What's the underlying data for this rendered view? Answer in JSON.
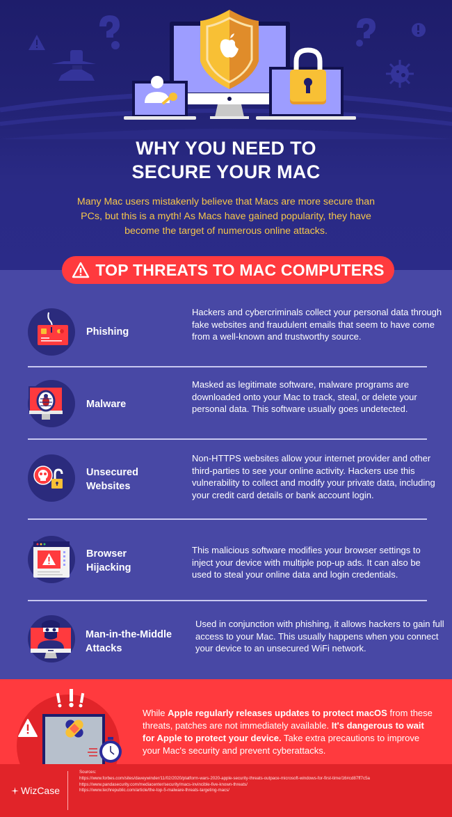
{
  "hero": {
    "title_line1": "WHY YOU NEED TO",
    "title_line2": "SECURE YOUR MAC",
    "intro": "Many Mac users mistakenly believe that Macs are more secure than PCs, but this is a myth! As Macs have gained popularity, they have become the target of numerous online attacks.",
    "illustration_icons": [
      "warning-icon",
      "question-mark-icon",
      "spy-icon",
      "apple-shield-icon",
      "user-key-icon",
      "padlock-icon",
      "exclamation-icon",
      "virus-icon"
    ]
  },
  "threats_section": {
    "badge_label": "TOP THREATS TO MAC COMPUTERS",
    "items": [
      {
        "name": "Phishing",
        "icon": "phishing-card-icon",
        "description": "Hackers and cybercriminals collect your personal data through fake websites and fraudulent emails that seem to have come from a well-known and trustworthy source."
      },
      {
        "name": "Malware",
        "icon": "malware-bug-icon",
        "description": "Masked as legitimate software, malware programs are downloaded onto your Mac to track, steal, or delete your personal data. This software usually goes undetected."
      },
      {
        "name_line1": "Unsecured",
        "name_line2": "Websites",
        "icon": "skull-unlocked-icon",
        "description": "Non-HTTPS websites allow your internet provider and other third-parties to see your online activity. Hackers use this vulnerability to collect and modify your private data, including your credit card details or bank account login."
      },
      {
        "name_line1": "Browser",
        "name_line2": "Hijacking",
        "icon": "browser-warning-icon",
        "description": "This malicious software modifies your browser settings to inject your device with multiple pop-up ads. It can also be used to steal your online data and login credentials."
      },
      {
        "name_line1": "Man-in-the-Middle",
        "name_line2": "Attacks",
        "icon": "hacker-monitor-icon",
        "description": "Used in conjunction with phishing, it allows hackers to gain full access to your Mac. This usually happens when you connect your device to an unsecured WiFi network."
      }
    ]
  },
  "warning": {
    "seg1": "While ",
    "seg2_bold": "Apple regularly releases updates to protect macOS",
    "seg3": " from these threats, patches are not immediately available. ",
    "seg4_bold": "It's dangerous to wait for Apple to protect your device.",
    "seg5": " Take extra precautions to improve your Mac's security and prevent cyberattacks."
  },
  "footer": {
    "brand": "WizCase",
    "sources_label": "Sources:",
    "sources": [
      "https://www.forbes.com/sites/daveywinder/11/02/2020/platform-wars-2020-apple-security-threats-outpace-microsoft-windows-for-first-time/16#cd87ff7c5a",
      "https://www.pandasecurity.com/mediacenter/security/macs-invincible-five-known-threats/",
      "https://www.techrepublic.com/article/the-top-5-malware-threats-targeting-macs/"
    ]
  },
  "colors": {
    "hero_bg": "#1e1d6b",
    "threats_bg": "#4848a5",
    "accent_red": "#ff3a3e",
    "footer_red": "#e12429",
    "intro_yellow": "#f6c64a",
    "shield_gold": "#f8c035"
  }
}
